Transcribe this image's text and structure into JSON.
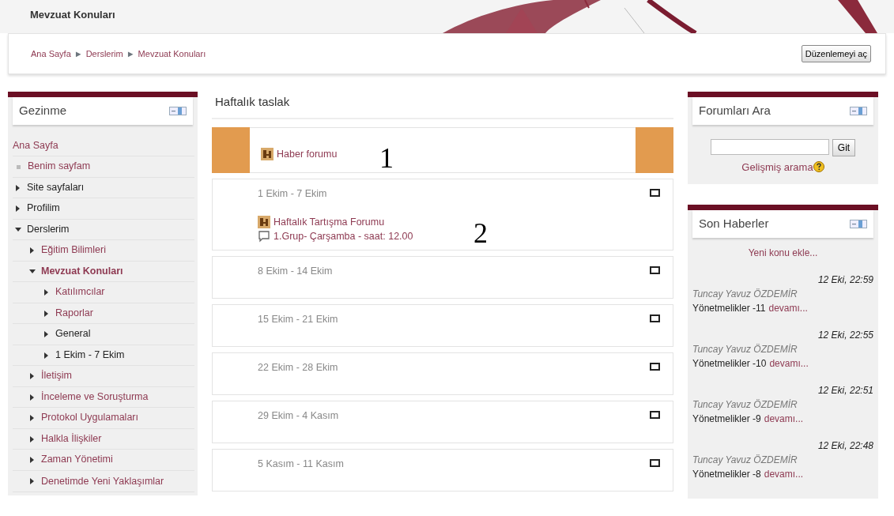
{
  "header": {
    "title": "Mevzuat Konuları"
  },
  "breadcrumb": {
    "items": [
      "Ana Sayfa",
      "Derslerim",
      "Mevzuat Konuları"
    ],
    "separator": "►"
  },
  "edit_button": "Düzenlemeyi aç",
  "navigation": {
    "title": "Gezinme",
    "items": [
      {
        "label": "Ana Sayfa",
        "kind": "plain",
        "link": true
      },
      {
        "label": "Benim sayfam",
        "kind": "bullet",
        "link": true
      },
      {
        "label": "Site sayfaları",
        "kind": "branch",
        "link": false,
        "expanded": false,
        "current": false
      },
      {
        "label": "Profilim",
        "kind": "branch",
        "link": false,
        "expanded": false,
        "current": false
      },
      {
        "label": "Derslerim",
        "kind": "branch",
        "link": false,
        "expanded": true,
        "current": false,
        "children": [
          {
            "label": "Eğitim Bilimleri",
            "kind": "branch",
            "link": true,
            "expanded": false,
            "current": false
          },
          {
            "label": "Mevzuat Konuları",
            "kind": "branch",
            "link": true,
            "expanded": true,
            "current": true,
            "children": [
              {
                "label": "Katılımcılar",
                "kind": "branch",
                "link": true,
                "expanded": false,
                "current": false
              },
              {
                "label": "Raporlar",
                "kind": "branch",
                "link": true,
                "expanded": false,
                "current": false
              },
              {
                "label": "General",
                "kind": "branch",
                "link": false,
                "expanded": false,
                "current": false
              },
              {
                "label": "1 Ekim - 7 Ekim",
                "kind": "branch",
                "link": false,
                "expanded": false,
                "current": false
              }
            ]
          },
          {
            "label": "İletişim",
            "kind": "branch",
            "link": true,
            "expanded": false,
            "current": false
          },
          {
            "label": "İnceleme ve Soruşturma",
            "kind": "branch",
            "link": true,
            "expanded": false,
            "current": false
          },
          {
            "label": "Protokol Uygulamaları",
            "kind": "branch",
            "link": true,
            "expanded": false,
            "current": false
          },
          {
            "label": "Halkla İlişkiler",
            "kind": "branch",
            "link": true,
            "expanded": false,
            "current": false
          },
          {
            "label": "Zaman Yönetimi",
            "kind": "branch",
            "link": true,
            "expanded": false,
            "current": false
          },
          {
            "label": "Denetimde Yeni Yaklaşımlar",
            "kind": "branch",
            "link": true,
            "expanded": false,
            "current": false
          }
        ]
      }
    ]
  },
  "course": {
    "title": "Haftalık taslak",
    "sections": [
      {
        "highlighted": true,
        "activities": [
          {
            "kind": "forum",
            "label": "Haber forumu"
          }
        ],
        "annotation": "1"
      },
      {
        "highlighted": false,
        "title": "1 Ekim - 7 Ekim",
        "activities": [
          {
            "kind": "forum",
            "label": "Haftalık Tartışma Forumu"
          },
          {
            "kind": "chat",
            "label": "1.Grup- Çarşamba - saat: 12.00"
          }
        ],
        "annotation": "2"
      },
      {
        "highlighted": false,
        "title": "8 Ekim - 14 Ekim"
      },
      {
        "highlighted": false,
        "title": "15 Ekim - 21 Ekim"
      },
      {
        "highlighted": false,
        "title": "22 Ekim - 28 Ekim"
      },
      {
        "highlighted": false,
        "title": "29 Ekim - 4 Kasım"
      },
      {
        "highlighted": false,
        "title": "5 Kasım - 11 Kasım"
      }
    ]
  },
  "forum_search": {
    "title": "Forumları Ara",
    "button": "Git",
    "advanced_link": "Gelişmiş arama"
  },
  "latest_news": {
    "title": "Son Haberler",
    "add_link": "Yeni konu ekle...",
    "posts": [
      {
        "date": "12 Eki, 22:59",
        "author": "Tuncay Yavuz ÖZDEMİR",
        "subject": "Yönetmelikler -11",
        "more": "devamı..."
      },
      {
        "date": "12 Eki, 22:55",
        "author": "Tuncay Yavuz ÖZDEMİR",
        "subject": "Yönetmelikler -10",
        "more": "devamı..."
      },
      {
        "date": "12 Eki, 22:51",
        "author": "Tuncay Yavuz ÖZDEMİR",
        "subject": "Yönetmelikler -9",
        "more": "devamı..."
      },
      {
        "date": "12 Eki, 22:48",
        "author": "Tuncay Yavuz ÖZDEMİR",
        "subject": "Yönetmelikler -8",
        "more": "devamı..."
      }
    ]
  }
}
